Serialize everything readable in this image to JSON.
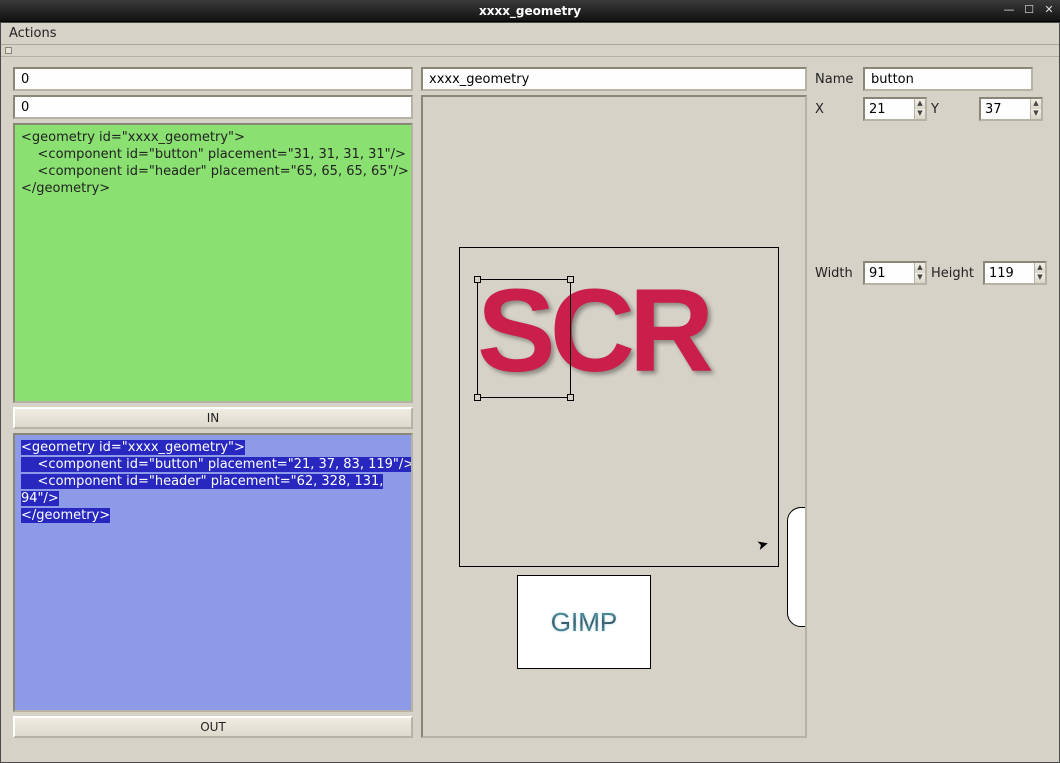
{
  "window": {
    "title": "xxxx_geometry"
  },
  "menubar": {
    "actions": "Actions"
  },
  "left": {
    "field1": "0",
    "field2": "0",
    "code_in_l1": "<geometry id=\"xxxx_geometry\">",
    "code_in_l2": "    <component id=\"button\" placement=\"31, 31, 31, 31\"/>",
    "code_in_l3": "    <component id=\"header\" placement=\"65, 65, 65, 65\"/>",
    "code_in_l4": "</geometry>",
    "btn_in": "IN",
    "code_out_l1": "<geometry id=\"xxxx_geometry\">",
    "code_out_l2": "    <component id=\"button\" placement=\"21, 37, 83, 119\"/>",
    "code_out_l3a": "    <component id=\"header\" placement=\"62, 328, 131,",
    "code_out_l3b": "94\"/>",
    "code_out_l4": "</geometry>",
    "btn_out": "OUT"
  },
  "mid": {
    "path": "xxxx_geometry",
    "scr_text": "SCR",
    "gimp_logo": "GIMP"
  },
  "props": {
    "name_label": "Name",
    "name_value": "button",
    "x_label": "X",
    "x_value": "21",
    "y_label": "Y",
    "y_value": "37",
    "w_label": "Width",
    "w_value": "91",
    "h_label": "Height",
    "h_value": "119"
  }
}
